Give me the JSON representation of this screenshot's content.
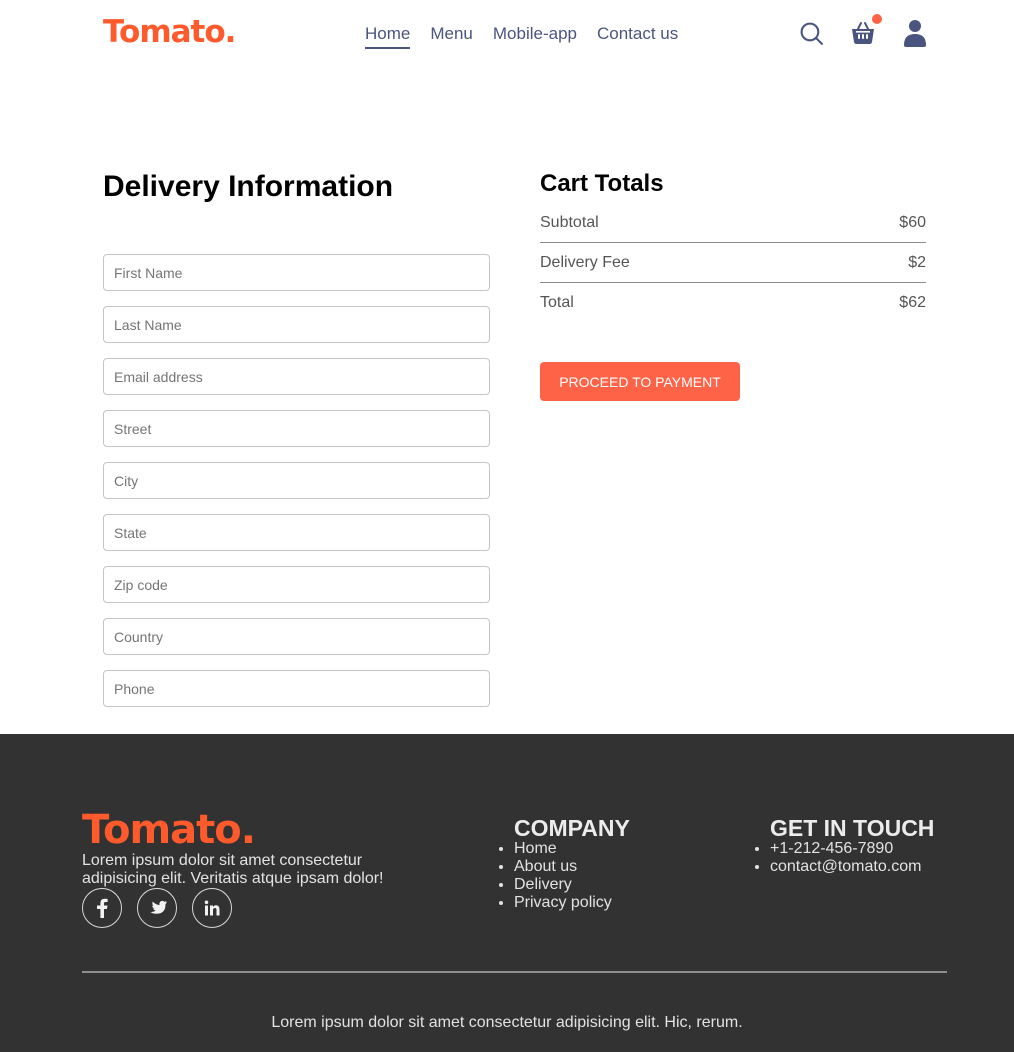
{
  "navbar": {
    "logo": "Tomato.",
    "links": [
      "Home",
      "Menu",
      "Mobile-app",
      "Contact us"
    ],
    "active_link": "Home",
    "icons": [
      "search-icon",
      "basket-icon",
      "profile-icon"
    ],
    "cart_dot_color": "#ff6347"
  },
  "delivery": {
    "title": "Delivery Information",
    "fields": [
      {
        "placeholder": "First Name",
        "value": ""
      },
      {
        "placeholder": "Last Name",
        "value": ""
      },
      {
        "placeholder": "Email address",
        "value": ""
      },
      {
        "placeholder": "Street",
        "value": ""
      },
      {
        "placeholder": "City",
        "value": ""
      },
      {
        "placeholder": "State",
        "value": ""
      },
      {
        "placeholder": "Zip code",
        "value": ""
      },
      {
        "placeholder": "Country",
        "value": ""
      },
      {
        "placeholder": "Phone",
        "value": ""
      }
    ]
  },
  "cart": {
    "title": "Cart Totals",
    "subtotal_label": "Subtotal",
    "subtotal_value": "$60",
    "delivery_label": "Delivery Fee",
    "delivery_value": "$2",
    "total_label": "Total",
    "total_value": "$62",
    "button_label": "PROCEED TO PAYMENT"
  },
  "footer": {
    "logo": "Tomato.",
    "description": "Lorem ipsum dolor sit amet consectetur adipisicing elit. Veritatis atque ipsam dolor!",
    "socials": [
      "facebook-icon",
      "twitter-icon",
      "linkedin-icon"
    ],
    "company_title": "COMPANY",
    "company_links": [
      "Home",
      "About us",
      "Delivery",
      "Privacy policy"
    ],
    "touch_title": "GET IN TOUCH",
    "touch_items": [
      "+1-212-456-7890",
      "contact@tomato.com"
    ],
    "copyright": "Lorem ipsum dolor sit amet consectetur adipisicing elit. Hic, rerum."
  },
  "colors": {
    "brand": "#ff5a2c",
    "accent": "#ff6347",
    "nav_text": "#49557e",
    "footer_bg": "#323232"
  }
}
